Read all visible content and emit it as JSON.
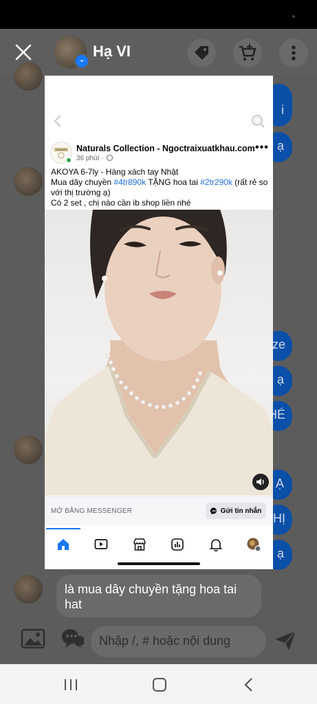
{
  "header": {
    "contact_name": "Hạ VI"
  },
  "chat": {
    "right_bubble_fragments": [
      "i",
      "ạ",
      "ze",
      "ạ",
      "HÉ",
      "Ạ",
      "HỊ",
      "ạ"
    ],
    "last_message": "là mua dây chuyền tặng hoa tai hat",
    "input_placeholder": "Nhập /, # hoặc nội dung"
  },
  "post": {
    "page_name": "Naturals Collection - Ngoctraixuatkhau.com",
    "time": "36 phút",
    "separator": "·",
    "line1": "AKOYA 6-7ly  - Hàng xách tay Nhật",
    "line2_prefix": "Mua dây chuyền ",
    "line2_tag1": "#4tr890k",
    "line2_middle": " TẶNG  hoa tai ",
    "line2_tag2": "#2tr290k",
    "line2_suffix": " (rất rẻ so với thị trường ạ)",
    "line3": "Có 2 set , chị nào cần ib shop liền nhé",
    "logo_text": "Naturals"
  },
  "cta": {
    "label": "MỞ BẰNG MESSENGER",
    "button": "Gửi tin nhắn"
  },
  "colors": {
    "accent": "#1877f2",
    "messenger_blue": "#0a4fa8",
    "overlay_dim": "#5c5c5c"
  },
  "icons": [
    "close-icon",
    "messenger-icon",
    "tag-icon",
    "cart-add-icon",
    "more-vertical-icon",
    "back-chevron-icon",
    "search-icon",
    "globe-icon",
    "more-horizontal-icon",
    "volume-icon",
    "messenger-small-icon",
    "home-icon",
    "watch-icon",
    "marketplace-icon",
    "feeds-icon",
    "bell-icon",
    "profile-avatar-icon",
    "image-icon",
    "sticker-icon",
    "send-icon",
    "recents-icon",
    "home-nav-icon",
    "back-nav-icon"
  ]
}
